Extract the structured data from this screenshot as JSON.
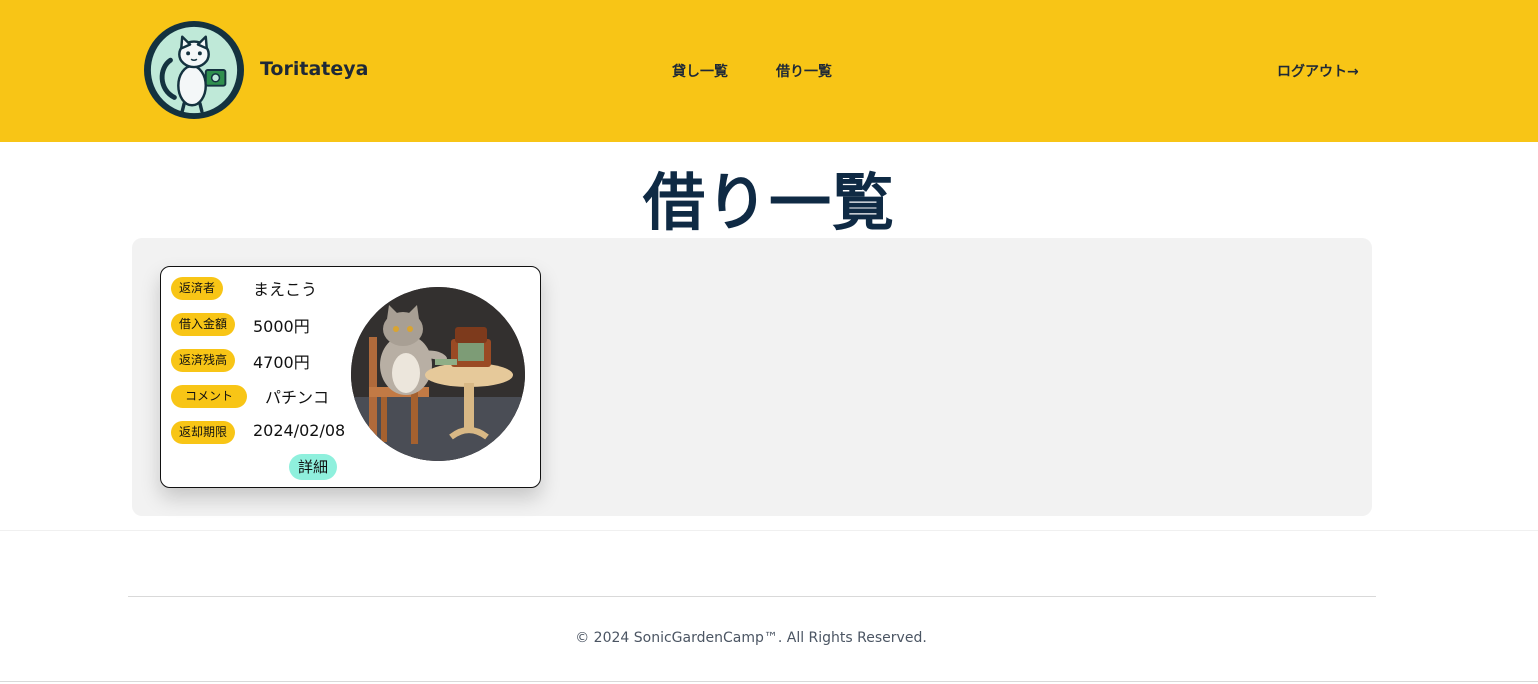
{
  "header": {
    "brand": "Toritateya",
    "nav": {
      "lend_list": "貸し一覧",
      "borrow_list": "借り一覧",
      "logout": "ログアウト→"
    }
  },
  "page": {
    "title": "借り一覧"
  },
  "card": {
    "repayer_label": "返済者",
    "repayer_value": "まえこう",
    "amount_label": "借入金額",
    "amount_value": "5000円",
    "balance_label": "返済残高",
    "balance_value": "4700円",
    "comment_label": "コメント",
    "comment_value": "パチンコ",
    "due_label": "返却期限",
    "due_value": "2024/02/08",
    "detail_button": "詳細"
  },
  "footer": {
    "copyright": "© 2024 SonicGardenCamp™. All Rights Reserved."
  },
  "colors": {
    "header_bg": "#f8c516",
    "title_color": "#0f2a44",
    "detail_button_bg": "#8ff0dd",
    "panel_bg": "#f2f2f2"
  },
  "icons": {
    "logo": "cat-holding-money-logo",
    "photo": "cat-with-money-suitcase-photo"
  }
}
